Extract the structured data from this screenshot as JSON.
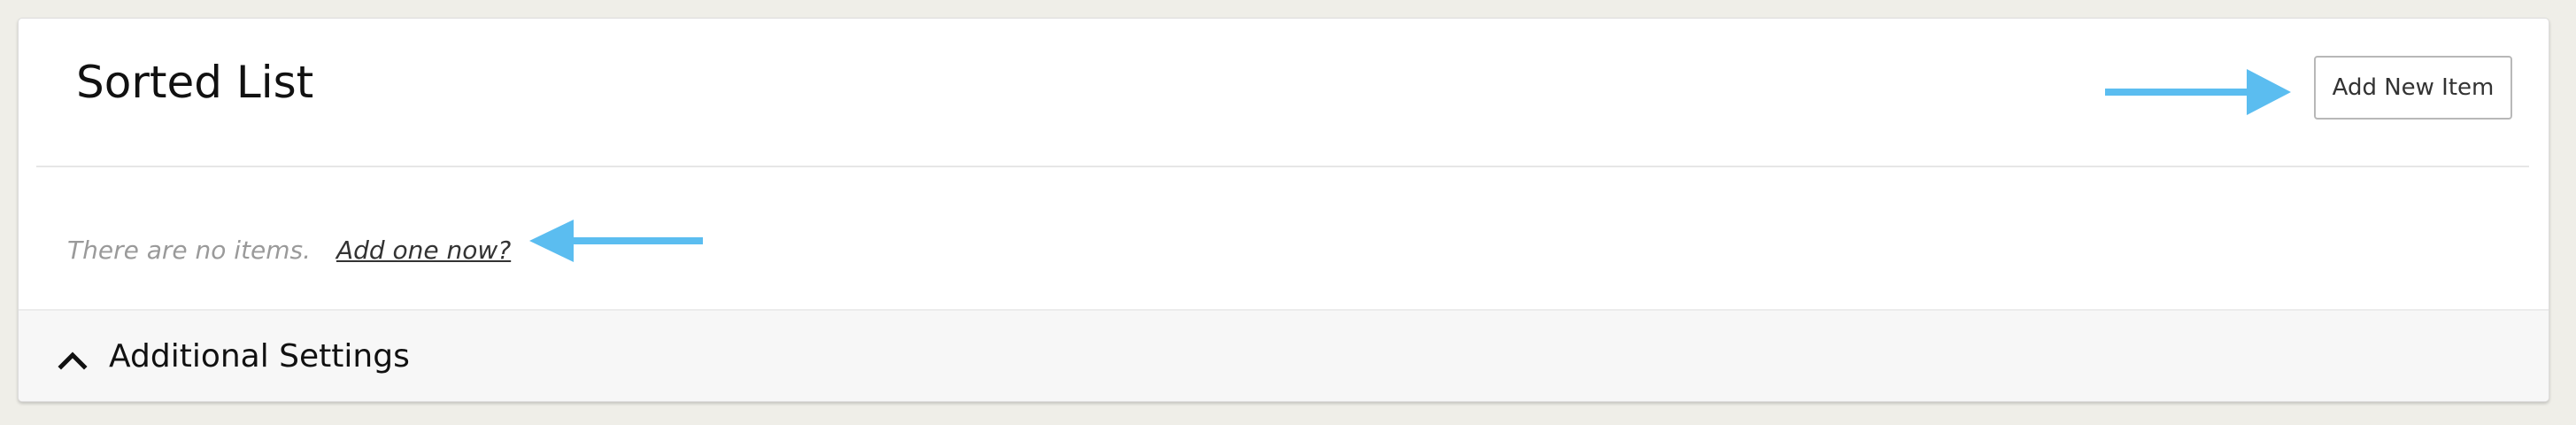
{
  "header": {
    "title": "Sorted List",
    "add_button_label": "Add New Item"
  },
  "empty_state": {
    "message": "There are no items.",
    "link_label": "Add one now?"
  },
  "settings": {
    "label": "Additional Settings",
    "icon": "chevron-up-icon"
  },
  "annotations": {
    "arrow_color": "#5bbdf0"
  }
}
